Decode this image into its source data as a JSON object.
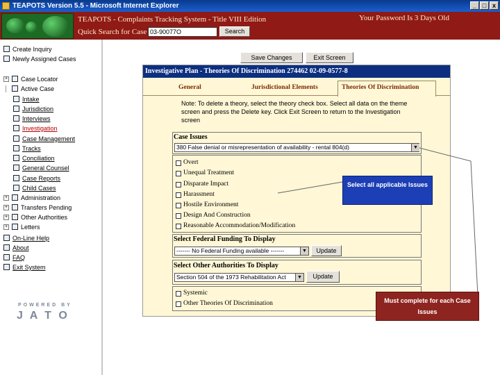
{
  "window": {
    "title": "TEAPOTS Version 5.5 - Microsoft Internet Explorer",
    "min": "_",
    "max": "□",
    "close": "x"
  },
  "header": {
    "app_title": "TEAPOTS - Complaints Tracking System - Title VIII Edition",
    "quick_search_label": "Quick Search for Case",
    "quick_search_value": "03-90077O",
    "search_button": "Search",
    "password_notice": "Your Password Is 3 Days Old"
  },
  "sidebar": {
    "top_items": [
      "Create Inquiry",
      "Newly Assigned Cases"
    ],
    "case_locator": "Case Locator",
    "active_case": "Active Case",
    "active_children": [
      "Intake",
      "Jurisdiction",
      "Interviews",
      "Investigation",
      "Case Management",
      "Tracks",
      "Conciliation",
      "General Counsel",
      "Case Reports",
      "Child Cases"
    ],
    "group_items": [
      "Administration",
      "Transfers Pending",
      "Other Authorities",
      "Letters"
    ],
    "bottom_items": [
      "On-Line Help",
      "About",
      "FAQ",
      "Exit System"
    ],
    "powered_by": "POWERED BY",
    "jato": "J A T O"
  },
  "main": {
    "save_button": "Save Changes",
    "exit_button": "Exit Screen",
    "title_bar": "Investigative Plan - Theories Of Discrimination    274462    02-09-0577-8",
    "tabs": [
      "General",
      "Jurisdictional Elements",
      "Theories Of Discrimination"
    ],
    "note": "Note: To delete a theory, select the theory check box. Select all data on the theme screen and press the Delete key. Click Exit Screen to return to the Investigation screen",
    "case_issues_label": "Case Issues",
    "case_issues_value": "380 False denial or misrepresentation of availability - rental 804(d)",
    "checkboxes": [
      "Overt",
      "Unequal Treatment",
      "Disparate Impact",
      "Harassment",
      "Hostile Environment",
      "Design And Construction",
      "Reasonable Accommodation/Modification"
    ],
    "funding_label": "Select Federal Funding To Display",
    "funding_value": "------- No Federal Funding available -------",
    "funding_button": "Update",
    "authorities_label": "Select Other Authorities To Display",
    "authorities_value": "Section 504 of the 1973 Rehabilitation Act",
    "authorities_button": "Update",
    "bottom_checkboxes": [
      "Systemic",
      "Other Theories Of Discrimination"
    ]
  },
  "callouts": {
    "issues": "Select all applicable Issues",
    "complete": "Must complete for each Case Issues"
  }
}
